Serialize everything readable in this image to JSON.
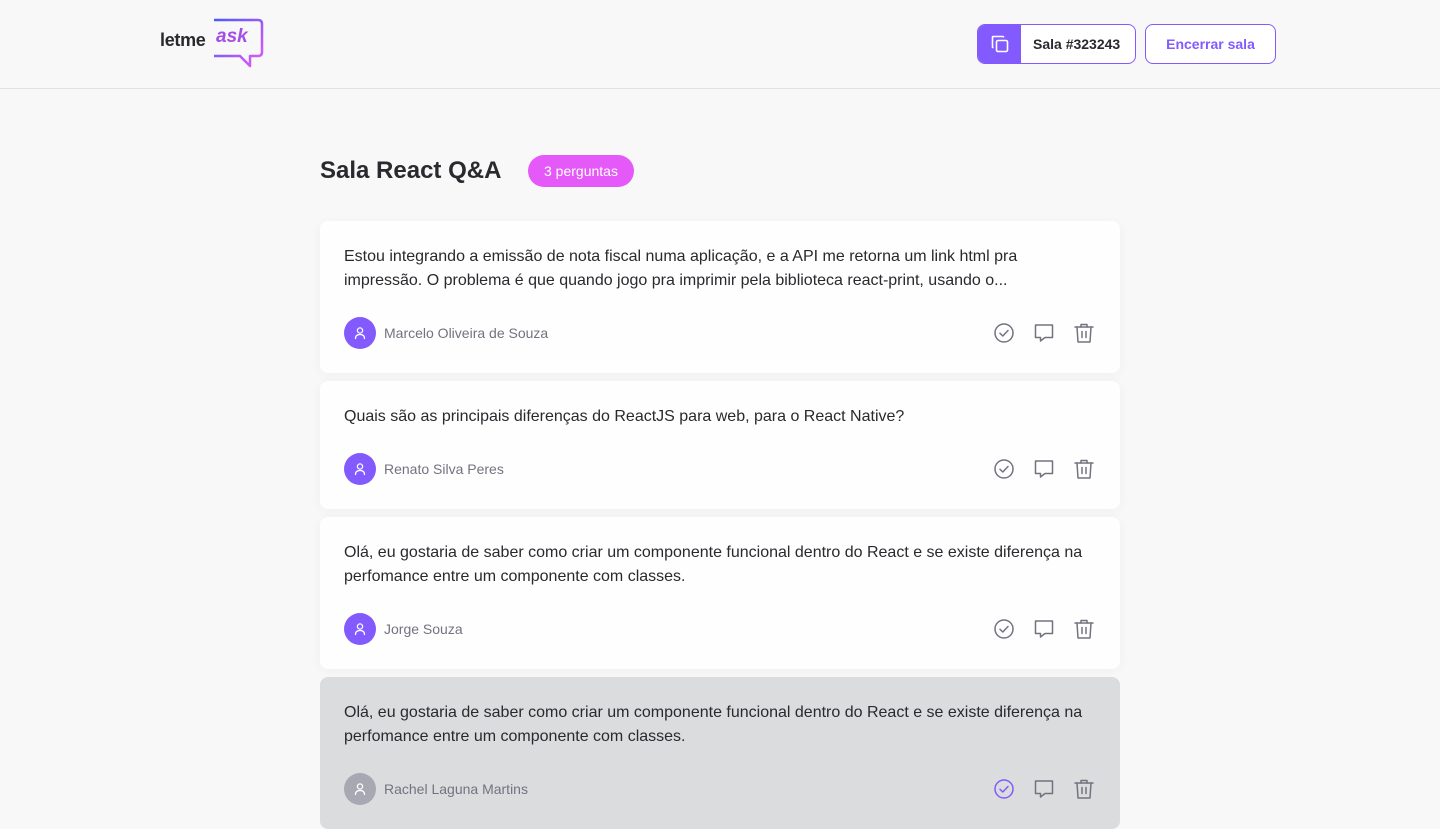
{
  "header": {
    "logo_part1": "letme",
    "logo_part2": "ask",
    "room_code_label": "Sala #323243",
    "close_room_label": "Encerrar sala"
  },
  "room": {
    "title": "Sala React Q&A",
    "question_count": "3 perguntas"
  },
  "questions": [
    {
      "content": "Estou integrando a emissão de nota fiscal numa aplicação, e a API me retorna um link html pra impressão. O problema é que quando jogo pra imprimir pela biblioteca react-print, usando o...",
      "author": "Marcelo Oliveira de Souza",
      "highlighted": false
    },
    {
      "content": "Quais são as principais diferenças do ReactJS para web, para o React Native?",
      "author": "Renato Silva Peres",
      "highlighted": false
    },
    {
      "content": "Olá, eu gostaria de saber como criar um componente funcional dentro do React e se existe diferença na perfomance entre um componente com classes.",
      "author": "Jorge Souza",
      "highlighted": false
    },
    {
      "content": "Olá, eu gostaria de saber como criar um componente funcional dentro do React e se existe diferença na perfomance entre um componente com classes.",
      "author": "Rachel Laguna Martins",
      "highlighted": true
    }
  ],
  "icons": {
    "copy": "copy-icon",
    "user": "user-icon",
    "check": "check-circle-icon",
    "answer": "chat-bubble-icon",
    "delete": "trash-icon"
  },
  "colors": {
    "primary": "#835afd",
    "badge": "#e559f9",
    "highlight_bg": "#dbdcdd",
    "text": "#29292e",
    "muted": "#737380"
  }
}
